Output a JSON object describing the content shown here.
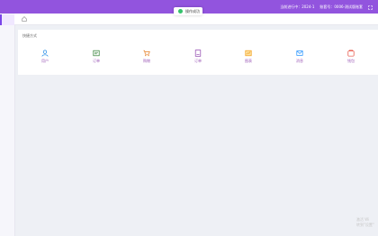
{
  "header": {
    "tenant_text": "当前进行中：2024-1",
    "account_text": "账套号：0006-测试版账套"
  },
  "toast": {
    "text": "操作成功"
  },
  "quick_access": {
    "title": "快捷方式",
    "items": [
      {
        "label": "用户",
        "icon": "user-icon",
        "color": "#1e88e5"
      },
      {
        "label": "订单",
        "icon": "list-icon",
        "color": "#2e7d32"
      },
      {
        "label": "购物",
        "icon": "cart-icon",
        "color": "#e67e22"
      },
      {
        "label": "订单",
        "icon": "document-icon",
        "color": "#8e44ad"
      },
      {
        "label": "图表",
        "icon": "chart-icon",
        "color": "#f39c12"
      },
      {
        "label": "消息",
        "icon": "mail-icon",
        "color": "#1e90ff"
      },
      {
        "label": "钱包",
        "icon": "wallet-icon",
        "color": "#e74c3c"
      }
    ]
  },
  "watermark": {
    "line1": "激活 Wi",
    "line2": "转到\"设置\""
  }
}
